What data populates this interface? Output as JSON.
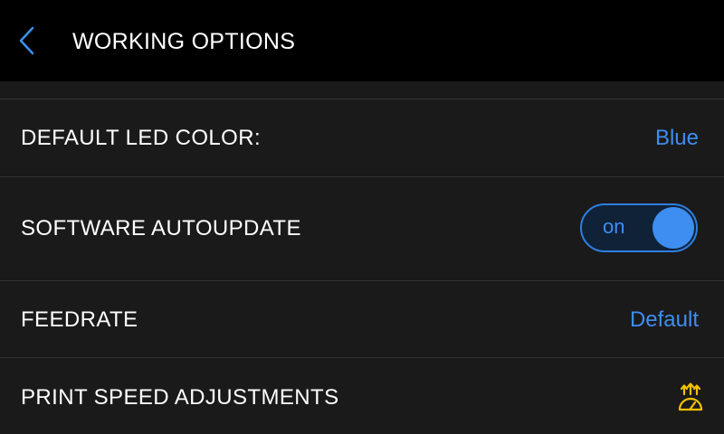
{
  "header": {
    "title": "WORKING OPTIONS",
    "back_icon": "chevron-left-icon"
  },
  "settings": {
    "led_color": {
      "label": "DEFAULT LED COLOR:",
      "value": "Blue"
    },
    "autoupdate": {
      "label": "SOFTWARE AUTOUPDATE",
      "toggle_text": "on",
      "enabled": true
    },
    "feedrate": {
      "label": "FEEDRATE",
      "value": "Default"
    },
    "print_speed": {
      "label": "PRINT SPEED ADJUSTMENTS",
      "icon": "speed-gauge-icon"
    }
  },
  "colors": {
    "accent": "#3d8ef0",
    "icon_yellow": "#f2c200",
    "background": "#1a1a1a",
    "header_background": "#000000"
  }
}
